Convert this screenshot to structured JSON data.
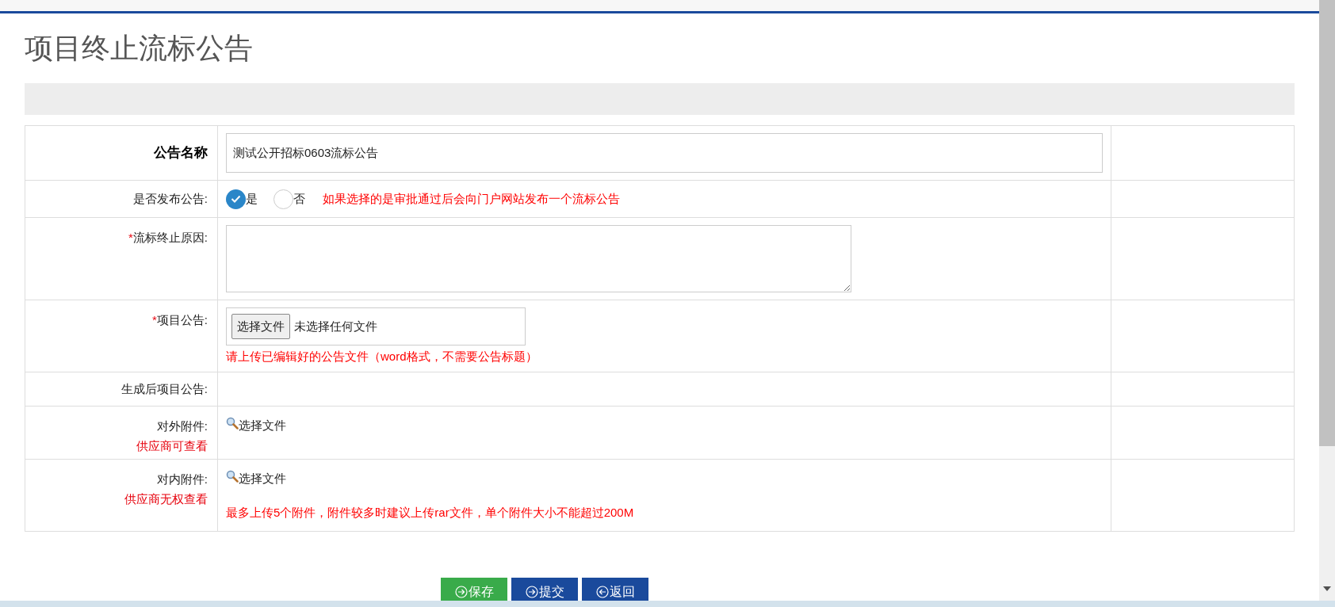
{
  "title": "项目终止流标公告",
  "form": {
    "name": {
      "label": "公告名称",
      "value": "测试公开招标0603流标公告"
    },
    "publish": {
      "label": "是否发布公告:",
      "options": [
        {
          "label": "是",
          "selected": true
        },
        {
          "label": "否",
          "selected": false
        }
      ],
      "hint": "如果选择的是审批通过后会向门户网站发布一个流标公告"
    },
    "reason": {
      "required_mark": "*",
      "label": "流标终止原因:"
    },
    "notice_file": {
      "required_mark": "*",
      "label": "项目公告:",
      "button": "选择文件",
      "status": "未选择任何文件",
      "hint": "请上传已编辑好的公告文件（word格式，不需要公告标题）"
    },
    "generated": {
      "label": "生成后项目公告:"
    },
    "attachments": [
      {
        "label": "对外附件:",
        "note": "供应商可查看",
        "link": "选择文件"
      },
      {
        "label": "对内附件:",
        "note": "供应商无权查看",
        "link": "选择文件",
        "hint": "最多上传5个附件，附件较多时建议上传rar文件，单个附件大小不能超过200M"
      }
    ]
  },
  "buttons": [
    {
      "label": "保存",
      "kind": "save"
    },
    {
      "label": "提交",
      "kind": "submit"
    },
    {
      "label": "返回",
      "kind": "back"
    }
  ]
}
